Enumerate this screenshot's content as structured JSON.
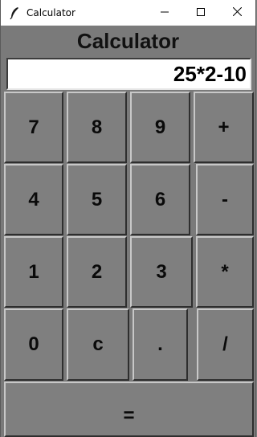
{
  "window": {
    "title": "Calculator",
    "icon": "feather-icon",
    "controls": [
      "minimize-icon",
      "maximize-icon",
      "close-icon"
    ]
  },
  "app": {
    "heading": "Calculator",
    "display_value": "25*2-10"
  },
  "keys": {
    "k7": "7",
    "k8": "8",
    "k9": "9",
    "plus": "+",
    "k4": "4",
    "k5": "5",
    "k6": "6",
    "minus": "-",
    "k1": "1",
    "k2": "2",
    "k3": "3",
    "multiply": "*",
    "k0": "0",
    "clear": "c",
    "dot": ".",
    "divide": "/",
    "equals": "="
  },
  "colors": {
    "background": "#7a7a7a",
    "button": "#7f7f7f",
    "display_bg": "#ffffff",
    "titlebar": "#ffffff"
  }
}
